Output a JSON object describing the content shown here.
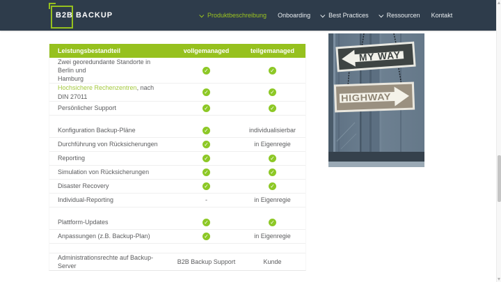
{
  "header": {
    "logo_text": "B2B BACKUP",
    "nav_items": [
      {
        "label": "Produktbeschreibung",
        "chevron": true,
        "active": true
      },
      {
        "label": "Onboarding",
        "chevron": false,
        "active": false
      },
      {
        "label": "Best Practices",
        "chevron": true,
        "active": false
      },
      {
        "label": "Ressourcen",
        "chevron": true,
        "active": false
      },
      {
        "label": "Kontakt",
        "chevron": false,
        "active": false
      }
    ]
  },
  "comparison_table": {
    "headers": [
      "Leistungsbestandteil",
      "vollgemanaged",
      "teilgemanaged"
    ],
    "rows": [
      {
        "label": "Zwei georedundante Standorte in Berlin und\nHamburg",
        "voll": "check",
        "teil": "check",
        "tall": true
      },
      {
        "link": "Hochsichere Rechenzentren",
        "rest": ", nach DIN 27011",
        "voll": "check",
        "teil": "check"
      },
      {
        "label": "Persönlicher Support",
        "voll": "check",
        "teil": "check"
      },
      {
        "spacer": true
      },
      {
        "label": "Konfiguration Backup-Pläne",
        "voll": "check",
        "teil": "individualisierbar"
      },
      {
        "label": "Durchführung von Rücksicherungen",
        "voll": "check",
        "teil": "in Eigenregie"
      },
      {
        "label": "Reporting",
        "voll": "check",
        "teil": "check"
      },
      {
        "label": "Simulation von Rücksicherungen",
        "voll": "check",
        "teil": "check"
      },
      {
        "label": "Disaster Recovery",
        "voll": "check",
        "teil": "check"
      },
      {
        "label": "Individual-Reporting",
        "voll": "-",
        "teil": "in Eigenregie"
      },
      {
        "spacer": true
      },
      {
        "label": "Plattform-Updates",
        "voll": "check",
        "teil": "check"
      },
      {
        "label": "Anpassungen (z.B. Backup-Plan)",
        "voll": "check",
        "teil": "in Eigenregie"
      },
      {
        "spacer": true,
        "border": true
      },
      {
        "label": "Administrationsrechte auf Backup-Server",
        "voll": "B2B Backup Support",
        "teil": "Kunde",
        "last": true
      }
    ]
  },
  "photo": {
    "sign_top": "MY WAY",
    "sign_bottom": "HIGHWAY"
  },
  "colors": {
    "header_navy": "#2e3c4b",
    "accent_green": "#96c11e",
    "check_green": "#8dc826"
  }
}
